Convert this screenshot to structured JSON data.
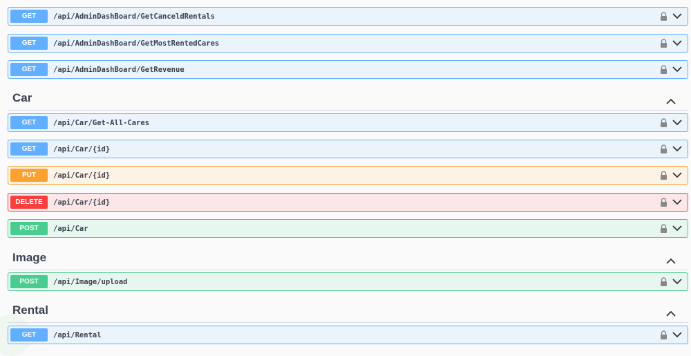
{
  "colors": {
    "get": "#61affe",
    "put": "#fca130",
    "delete": "#f93e3e",
    "post": "#49cc90"
  },
  "ops_top": [
    {
      "method": "GET",
      "path": "/api/AdminDashBoard/GetCanceldRentals"
    },
    {
      "method": "GET",
      "path": "/api/AdminDashBoard/GetMostRentedCares"
    },
    {
      "method": "GET",
      "path": "/api/AdminDashBoard/GetRevenue"
    }
  ],
  "car": {
    "title": "Car",
    "ops": [
      {
        "method": "GET",
        "path": "/api/Car/Get-All-Cares"
      },
      {
        "method": "GET",
        "path": "/api/Car/{id}"
      },
      {
        "method": "PUT",
        "path": "/api/Car/{id}"
      },
      {
        "method": "DELETE",
        "path": "/api/Car/{id}"
      },
      {
        "method": "POST",
        "path": "/api/Car"
      }
    ]
  },
  "image": {
    "title": "Image",
    "ops": [
      {
        "method": "POST",
        "path": "/api/Image/upload"
      }
    ]
  },
  "rental": {
    "title": "Rental",
    "ops": [
      {
        "method": "GET",
        "path": "/api/Rental"
      }
    ]
  },
  "icons": {
    "lock": "lock-icon",
    "expand": "chevron-down-icon",
    "collapse": "chevron-up-icon"
  }
}
